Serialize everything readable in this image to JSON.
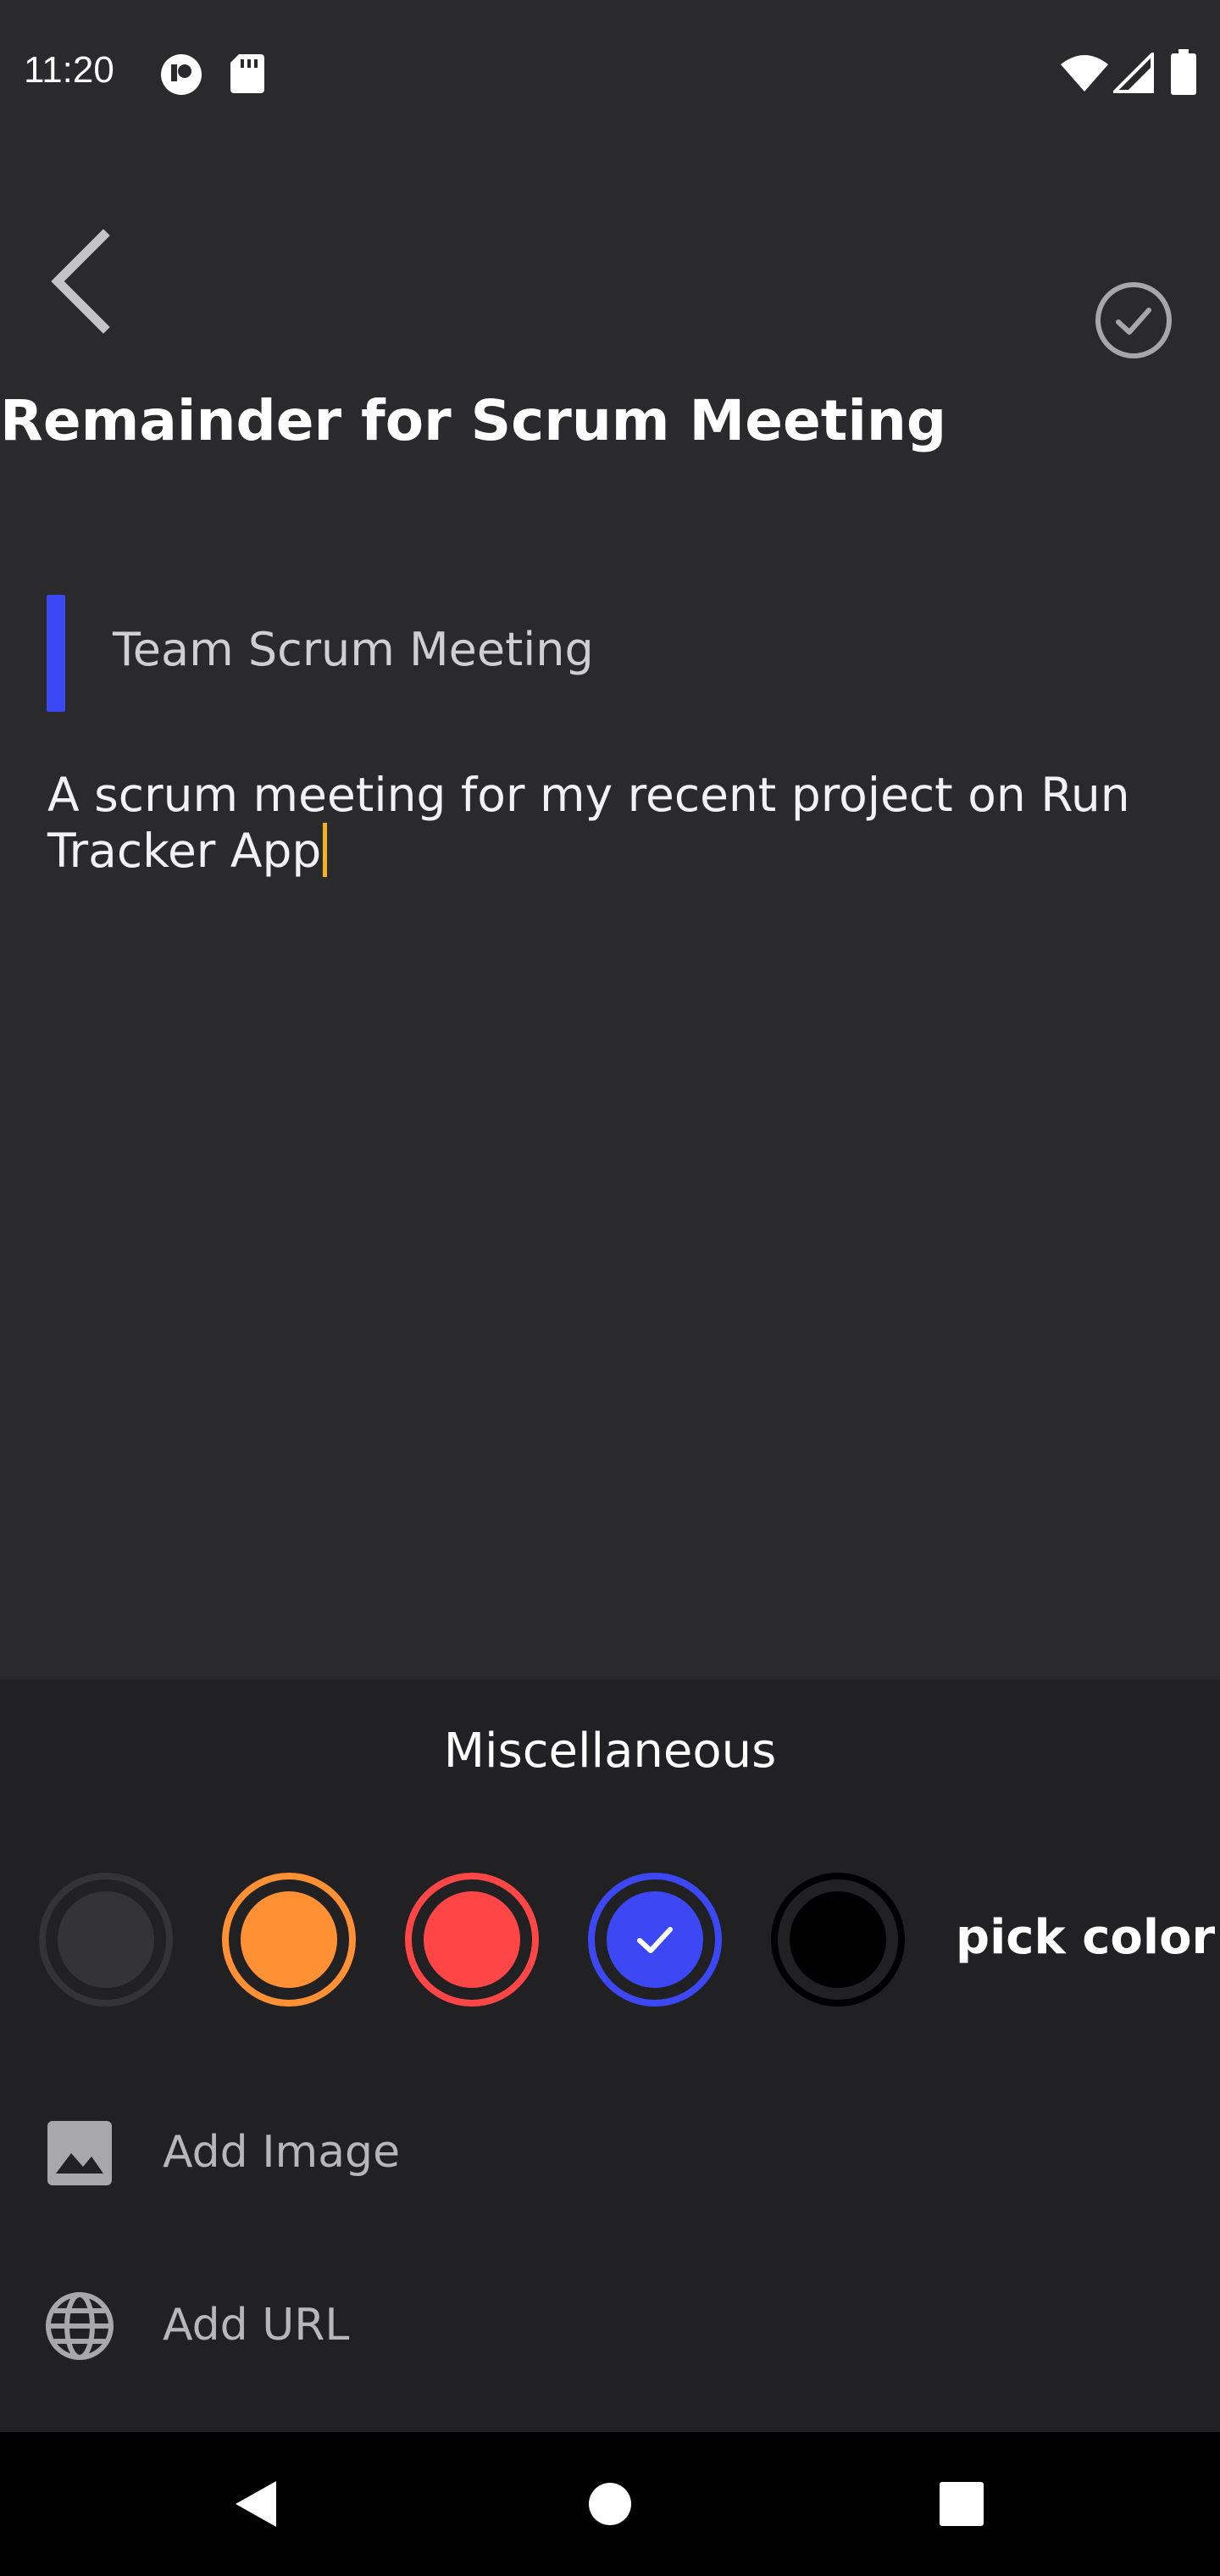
{
  "status_bar": {
    "time": "11:20",
    "icons": [
      "notification-icon",
      "sd-card-icon",
      "wifi-icon",
      "signal-icon",
      "battery-icon"
    ]
  },
  "toolbar": {
    "back_icon": "chevron-left-icon",
    "done_icon": "check-circle-icon"
  },
  "note": {
    "title": "Remainder for Scrum Meeting",
    "subtitle": "Team Scrum Meeting",
    "body": "A scrum meeting for my recent project on Run Tracker App",
    "accent_color": "#3d48f5",
    "caret_color": "#f4b21e"
  },
  "sheet": {
    "title": "Miscellaneous",
    "colors": [
      {
        "name": "default",
        "ring": "#343436",
        "fill": "#343436",
        "selected": false
      },
      {
        "name": "orange",
        "ring": "#ff9033",
        "fill": "#ff9033",
        "selected": false
      },
      {
        "name": "red",
        "ring": "#ff4647",
        "fill": "#ff4647",
        "selected": false
      },
      {
        "name": "blue",
        "ring": "#3d48f5",
        "fill": "#3d48f5",
        "selected": true
      },
      {
        "name": "black",
        "ring": "#000000",
        "fill": "#000000",
        "selected": false
      }
    ],
    "pick_color_label": "pick color",
    "add_image_label": "Add Image",
    "add_url_label": "Add URL"
  },
  "nav_bar": {
    "buttons": [
      "back-triangle-icon",
      "home-circle-icon",
      "recents-square-icon"
    ]
  }
}
